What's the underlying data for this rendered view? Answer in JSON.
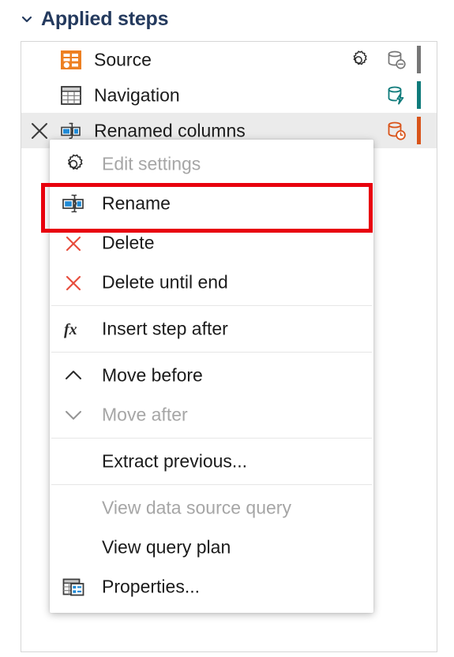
{
  "header": {
    "chevron_icon": "chevron-down-icon",
    "title": "Applied steps"
  },
  "colors": {
    "title": "#243a5e",
    "highlight_border": "#e8000d",
    "source_orange": "#ed8022",
    "delete_red": "#e74c3c",
    "accent_gray": "#767676",
    "accent_teal": "#0f7b7b",
    "accent_orange": "#d9541a",
    "selected_row_bg": "#ebebeb",
    "menu_bg": "#ffffff",
    "disabled_text": "#a6a6a6"
  },
  "steps": [
    {
      "label": "Source",
      "icon": "source-table-icon",
      "has_delete": false,
      "has_gear": true,
      "gear_icon": "gear-icon",
      "db_icon": "database-minus-icon",
      "db_color": "#767676",
      "accent_color": "#767676",
      "selected": false
    },
    {
      "label": "Navigation",
      "icon": "navigation-table-icon",
      "has_delete": false,
      "has_gear": false,
      "gear_icon": "",
      "db_icon": "database-lightning-icon",
      "db_color": "#0f7b7b",
      "accent_color": "#0f7b7b",
      "selected": false
    },
    {
      "label": "Renamed columns",
      "icon": "rename-columns-icon",
      "has_delete": true,
      "delete_icon": "close-icon",
      "has_gear": false,
      "gear_icon": "",
      "db_icon": "database-clock-icon",
      "db_color": "#d9541a",
      "accent_color": "#d9541a",
      "selected": true
    }
  ],
  "context_menu": {
    "items": [
      {
        "label": "Edit settings",
        "icon": "gear-icon",
        "disabled": true,
        "highlighted": false,
        "sep_after": false
      },
      {
        "label": "Rename",
        "icon": "rename-icon",
        "disabled": false,
        "highlighted": true,
        "sep_after": false
      },
      {
        "label": "Delete",
        "icon": "delete-x-icon",
        "disabled": false,
        "highlighted": false,
        "sep_after": false
      },
      {
        "label": "Delete until end",
        "icon": "delete-x-icon",
        "disabled": false,
        "highlighted": false,
        "sep_after": true
      },
      {
        "label": "Insert step after",
        "icon": "fx-icon",
        "disabled": false,
        "highlighted": false,
        "sep_after": true
      },
      {
        "label": "Move before",
        "icon": "chevron-up-icon",
        "disabled": false,
        "highlighted": false,
        "sep_after": false
      },
      {
        "label": "Move after",
        "icon": "chevron-down-icon",
        "disabled": true,
        "highlighted": false,
        "sep_after": true
      },
      {
        "label": "Extract previous...",
        "icon": "",
        "disabled": false,
        "highlighted": false,
        "sep_after": true
      },
      {
        "label": "View data source query",
        "icon": "",
        "disabled": true,
        "highlighted": false,
        "sep_after": false
      },
      {
        "label": "View query plan",
        "icon": "",
        "disabled": false,
        "highlighted": false,
        "sep_after": false
      },
      {
        "label": "Properties...",
        "icon": "properties-table-icon",
        "disabled": false,
        "highlighted": false,
        "sep_after": false
      }
    ]
  }
}
